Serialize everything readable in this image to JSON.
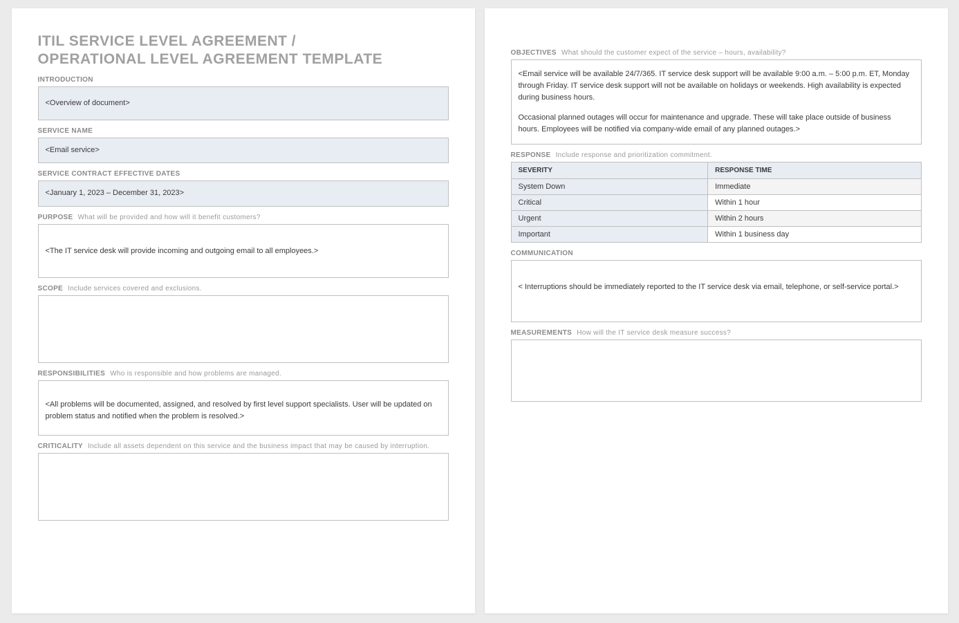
{
  "title_line1": "ITIL SERVICE LEVEL AGREEMENT /",
  "title_line2": "OPERATIONAL LEVEL AGREEMENT TEMPLATE",
  "sections": {
    "introduction": {
      "label": "INTRODUCTION",
      "value": "<Overview of document>"
    },
    "service_name": {
      "label": "SERVICE NAME",
      "value": "<Email service>"
    },
    "effective_dates": {
      "label": "SERVICE CONTRACT EFFECTIVE DATES",
      "value": "<January 1, 2023 – December 31, 2023>"
    },
    "purpose": {
      "label": "PURPOSE",
      "hint": "What will be provided and how will it benefit customers?",
      "value": "<The IT service desk will provide incoming and outgoing email to all employees.>"
    },
    "scope": {
      "label": "SCOPE",
      "hint": "Include services covered and exclusions.",
      "value": ""
    },
    "responsibilities": {
      "label": "RESPONSIBILITIES",
      "hint": "Who is responsible and how problems are managed.",
      "value": "<All problems will be documented, assigned, and resolved by first level support specialists. User will be updated on problem status and notified when the problem is resolved.>"
    },
    "criticality": {
      "label": "CRITICALITY",
      "hint": "Include all assets dependent on this service and the business impact that may be caused by interruption.",
      "value": ""
    },
    "objectives": {
      "label": "OBJECTIVES",
      "hint": "What should the customer expect of the service – hours, availability?",
      "value_p1": "<Email service will be available 24/7/365. IT service desk support will be available 9:00 a.m. – 5:00 p.m. ET, Monday through Friday. IT service desk support will not be available on holidays or weekends. High availability is expected during business hours.",
      "value_p2": "Occasional planned outages will occur for maintenance and upgrade. These will take place outside of business hours. Employees will be notified via company-wide email of any planned outages.>"
    },
    "response": {
      "label": "RESPONSE",
      "hint": "Include response and prioritization commitment.",
      "header_severity": "SEVERITY",
      "header_time": "RESPONSE TIME",
      "rows": [
        {
          "severity": "System Down",
          "time": "Immediate"
        },
        {
          "severity": "Critical",
          "time": "Within 1 hour"
        },
        {
          "severity": "Urgent",
          "time": "Within 2 hours"
        },
        {
          "severity": "Important",
          "time": "Within 1 business day"
        }
      ]
    },
    "communication": {
      "label": "COMMUNICATION",
      "value": "< Interruptions should be immediately reported to the IT service desk via email, telephone, or self-service portal.>"
    },
    "measurements": {
      "label": "MEASUREMENTS",
      "hint": "How will the IT service desk measure success?",
      "value": ""
    }
  }
}
